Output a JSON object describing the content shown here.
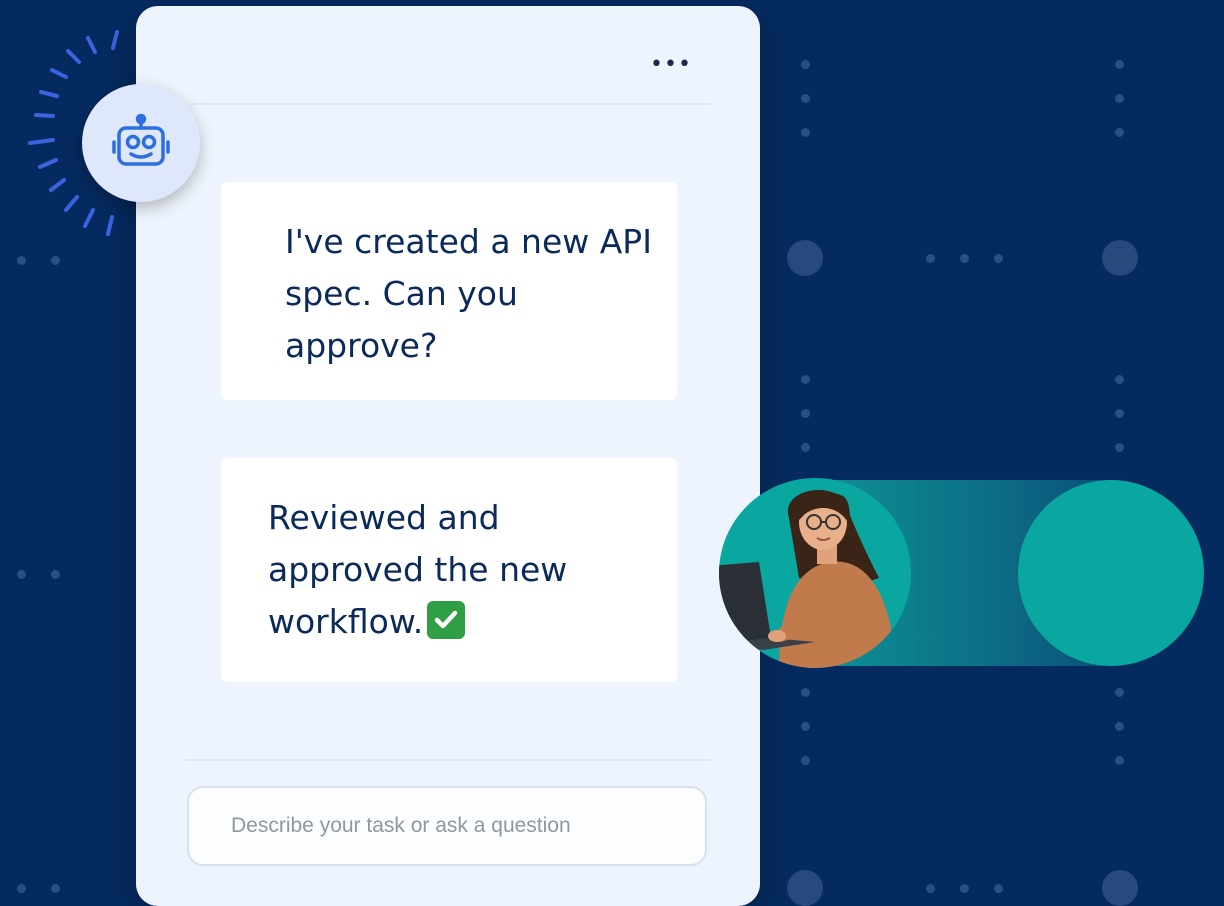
{
  "menu": {
    "more_label": "•••"
  },
  "messages": {
    "bot": {
      "text": "I've created a new API spec. Can you approve?"
    },
    "user": {
      "text": "Reviewed and approved the new workflow."
    }
  },
  "composer": {
    "placeholder": "Describe your task or ask a question"
  },
  "icons": {
    "bot_avatar": "robot-face-icon",
    "checkmark": "check-mark-button-icon",
    "more": "more-horizontal-icon"
  },
  "colors": {
    "background": "#052a5f",
    "panel": "#eef4fd",
    "accent_teal": "#0aa7a0",
    "bot_blue": "#2b6fe0"
  }
}
